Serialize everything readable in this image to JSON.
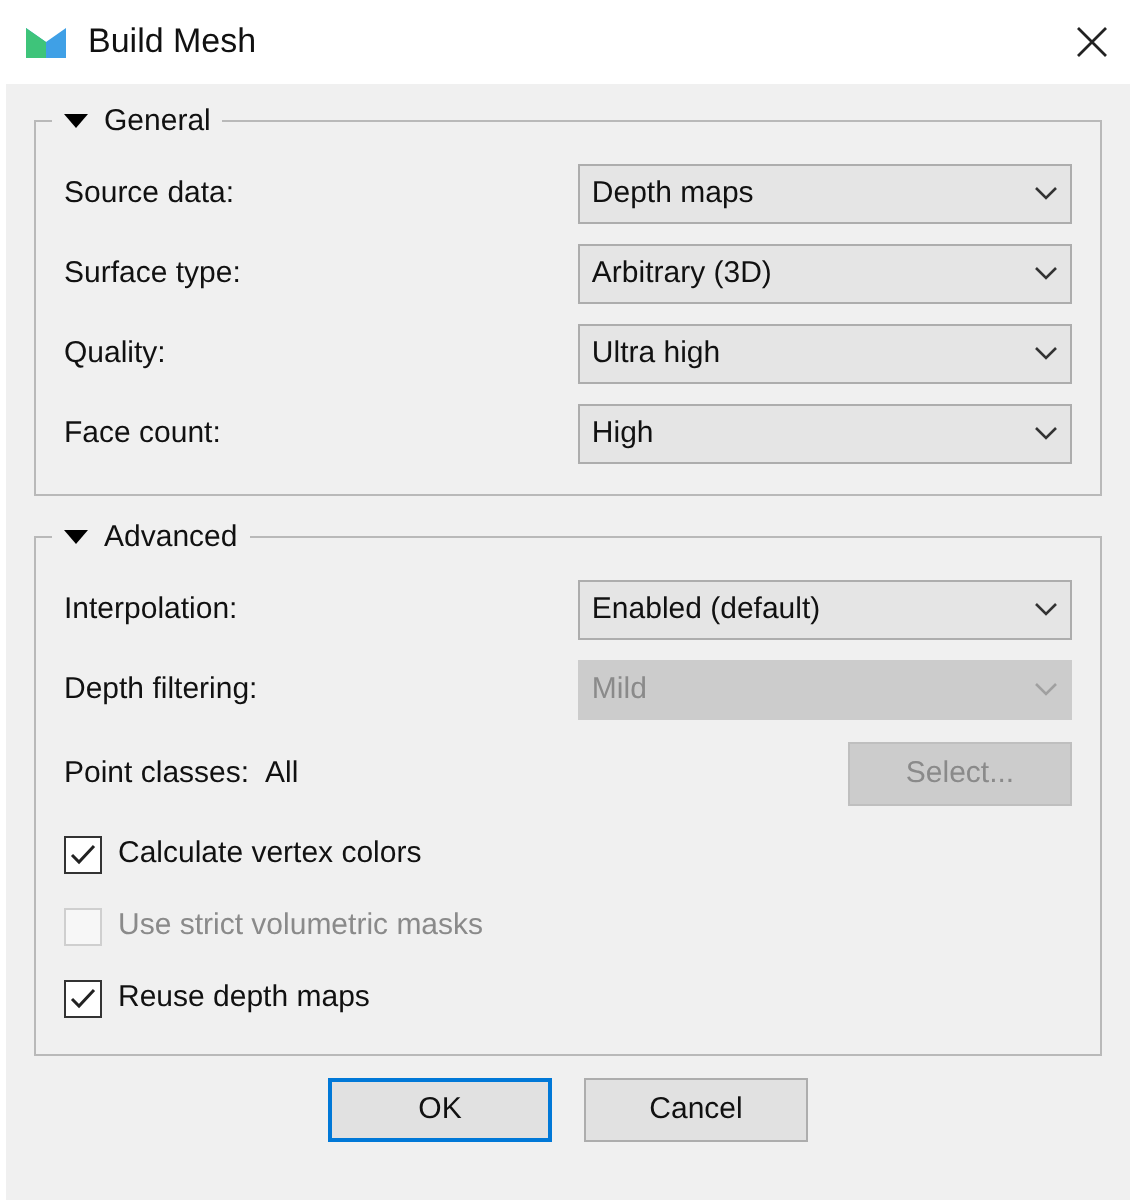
{
  "window": {
    "title": "Build Mesh"
  },
  "sections": [
    {
      "title": "General",
      "expanded": true,
      "rows": [
        {
          "kind": "combo",
          "label": "Source data:",
          "value": "Depth maps",
          "disabled": false
        },
        {
          "kind": "combo",
          "label": "Surface type:",
          "value": "Arbitrary (3D)",
          "disabled": false
        },
        {
          "kind": "combo",
          "label": "Quality:",
          "value": "Ultra high",
          "disabled": false
        },
        {
          "kind": "combo",
          "label": "Face count:",
          "value": "High",
          "disabled": false
        }
      ]
    },
    {
      "title": "Advanced",
      "expanded": true,
      "rows": [
        {
          "kind": "combo",
          "label": "Interpolation:",
          "value": "Enabled (default)",
          "disabled": false
        },
        {
          "kind": "combo",
          "label": "Depth filtering:",
          "value": "Mild",
          "disabled": true
        },
        {
          "kind": "picker",
          "label": "Point classes:",
          "value": "All",
          "button": "Select...",
          "disabled": true
        },
        {
          "kind": "checkbox",
          "label": "Calculate vertex colors",
          "checked": true,
          "disabled": false
        },
        {
          "kind": "checkbox",
          "label": "Use strict volumetric masks",
          "checked": false,
          "disabled": true
        },
        {
          "kind": "checkbox",
          "label": "Reuse depth maps",
          "checked": true,
          "disabled": false
        }
      ]
    }
  ],
  "buttons": [
    {
      "label": "OK",
      "default": true
    },
    {
      "label": "Cancel",
      "default": false
    }
  ]
}
